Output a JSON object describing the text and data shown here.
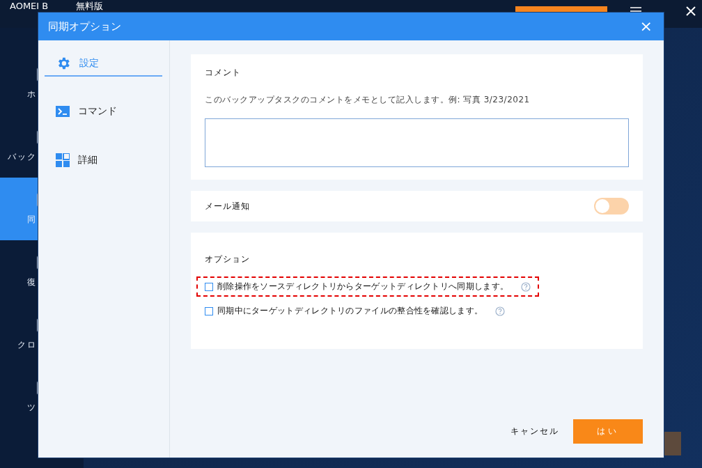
{
  "app": {
    "title": "AOMEI B",
    "edition": "無料版",
    "nav": [
      {
        "label": "ホ",
        "selected": false
      },
      {
        "label": "バック",
        "selected": false
      },
      {
        "label": "同",
        "selected": true
      },
      {
        "label": "復",
        "selected": false
      },
      {
        "label": "クロ",
        "selected": false
      },
      {
        "label": "ツ",
        "selected": false
      }
    ]
  },
  "dialog": {
    "title": "同期オプション",
    "close": "×",
    "sidebar": [
      {
        "label": "設定",
        "kind": "gear",
        "selected": true
      },
      {
        "label": "コマンド",
        "kind": "terminal",
        "selected": false
      },
      {
        "label": "詳細",
        "kind": "grid",
        "selected": false
      }
    ],
    "comment": {
      "heading": "コメント",
      "description": "このバックアップタスクのコメントをメモとして記入します。例: 写真 3/23/2021"
    },
    "email": {
      "label": "メール通知",
      "on": false
    },
    "options": {
      "heading": "オプション",
      "items": [
        {
          "label": "削除操作をソースディレクトリからターゲットディレクトリへ同期します。",
          "checked": false,
          "highlighted": true
        },
        {
          "label": "同期中にターゲットディレクトリのファイルの整合性を確認します。",
          "checked": false,
          "highlighted": false
        }
      ]
    },
    "buttons": {
      "cancel": "キャンセル",
      "ok": "はい"
    }
  }
}
